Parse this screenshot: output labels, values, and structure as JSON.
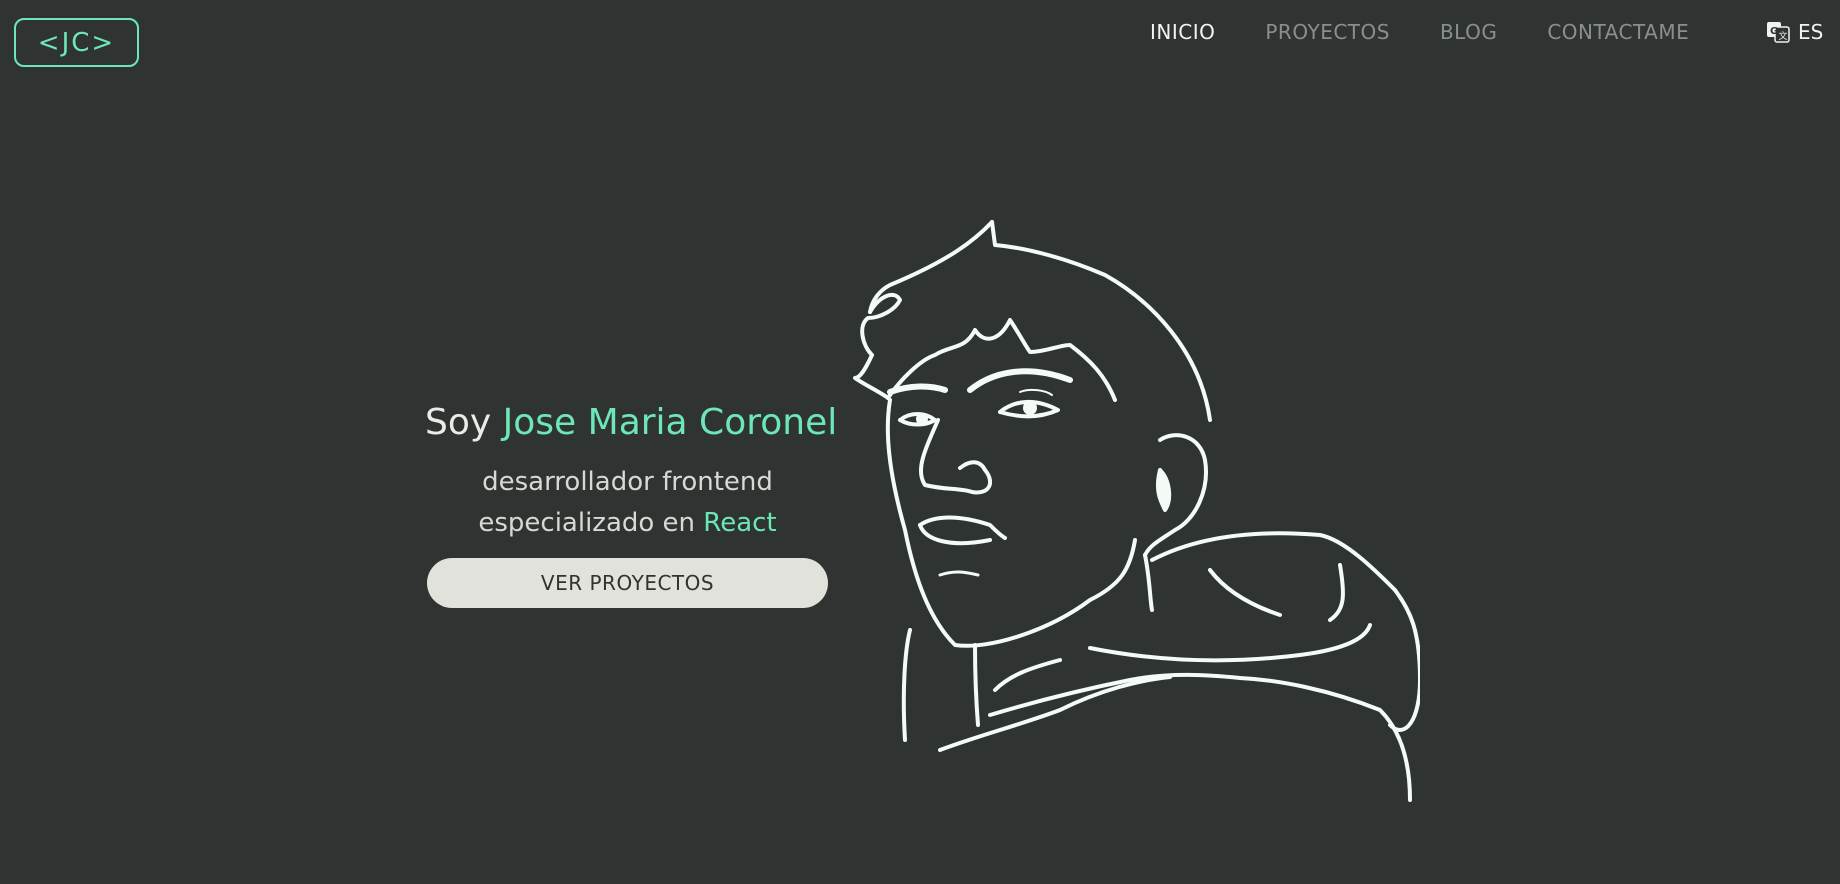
{
  "header": {
    "logo": "<JC>",
    "nav": [
      "INICIO",
      "PROYECTOS",
      "BLOG",
      "CONTACTAME"
    ],
    "active_nav": "INICIO",
    "language": {
      "icon": "translate-icon",
      "label": "ES"
    }
  },
  "hero": {
    "greeting": "Soy",
    "name": "Jose Maria Coronel",
    "role_line1": "desarrollador frontend",
    "role_line2_prefix": "especializado en",
    "role_tech": "React",
    "cta_label": "VER PROYECTOS"
  },
  "colors": {
    "background": "#2f3432",
    "accent": "#6ee7b7",
    "text_light": "#ecebe6",
    "nav_inactive": "#8a8f8c",
    "button_bg": "#e2e2dc"
  }
}
